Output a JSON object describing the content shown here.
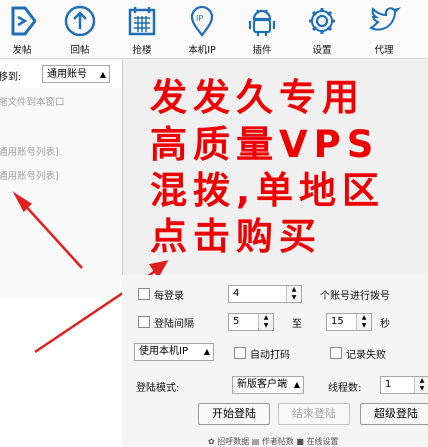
{
  "toolbar": {
    "items": [
      {
        "label": "发帖",
        "icon": "post-icon"
      },
      {
        "label": "回帖",
        "icon": "upload-circle-icon"
      },
      {
        "label": "抢楼",
        "icon": "calendar-grid-icon"
      },
      {
        "label": "本机IP",
        "icon": "ip-location-icon"
      },
      {
        "label": "插件",
        "icon": "android-robot-icon"
      },
      {
        "label": "设置",
        "icon": "gear-icon"
      },
      {
        "label": "代理",
        "icon": "twitter-bird-icon"
      }
    ],
    "icon_color": "#1f6fb8"
  },
  "left_panel": {
    "move_label": "移到:",
    "account_type": "通用账号",
    "hint_drag": "拖文件到本窗口",
    "hint_list": "通用账号列表].",
    "hint_list2": "通用账号列表]"
  },
  "promo": {
    "line1": "发发久专用",
    "line2": "高质量VPS",
    "line3": "混拨,单地区",
    "line4": "点击购买",
    "color": "#ee0000"
  },
  "settings": {
    "every_login_label": "每登录",
    "every_login_value": "4",
    "dial_label": "个账号进行拨号",
    "login_interval_label": "登陆间隔",
    "interval_from": "5",
    "to_label": "至",
    "interval_to": "15",
    "seconds_label": "秒",
    "ip_mode": "使用本机IP",
    "auto_captcha": "自动打码",
    "record_failure": "记录失败",
    "login_mode_label": "登陆模式:",
    "login_mode": "新版客户端",
    "threads_label": "线程数:",
    "threads_value": "1",
    "start_button": "开始登陆",
    "stop_button": "结束登陆",
    "super_button": "超级登陆"
  },
  "statusbar": {
    "text": "✿ 招呼数据  ▤ 作者帖数  ■ 在线设置"
  }
}
